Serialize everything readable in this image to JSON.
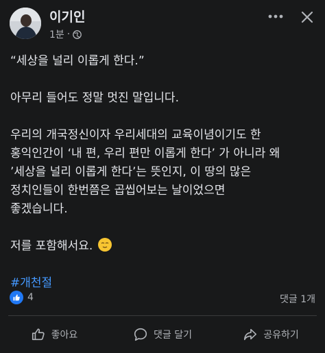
{
  "post": {
    "author": "이기인",
    "time": "1분",
    "separator": "·",
    "privacy_icon": "globe-icon",
    "paragraphs": [
      [
        "“세상을 널리 이롭게 한다.”"
      ],
      [
        "아무리 들어도 정말 멋진 말입니다."
      ],
      [
        "우리의 개국정신이자 우리세대의 교육이념이기도 한",
        "홍익인간이 ‘내 편, 우리 편만 이롭게 한다’ 가 아니라 왜",
        "’세상을 널리 이롭게 한다’는 뜻인지, 이 땅의 많은",
        "정치인들이 한번쯤은 곱씹어보는 날이었으면",
        "좋겠습니다."
      ],
      [
        "저를 포함해서요."
      ]
    ],
    "emoji": "relieved-face-emoji",
    "hashtag": "#개천절"
  },
  "engagement": {
    "reaction_icon": "like-icon",
    "reaction_count": "4",
    "comment_count": "댓글 1개"
  },
  "actions": {
    "like": "좋아요",
    "comment": "댓글 달기",
    "share": "공유하기"
  },
  "colors": {
    "background": "#18191a",
    "text": "#e4e6eb",
    "muted": "#b0b3b8",
    "hashtag": "#4599ff",
    "like_blue": "#2078f4"
  }
}
